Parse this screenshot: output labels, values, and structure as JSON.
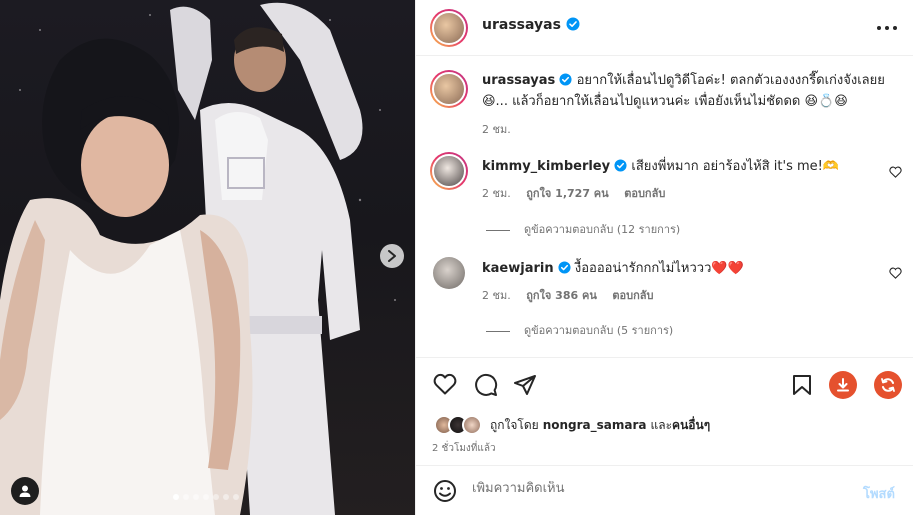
{
  "post": {
    "author": "urassayas",
    "caption_line1": "อยากให้เลื่อนไปดูวิดีโอค่ะ! ตลกตัวเองงงกรี๊ดเก่งจังเลยย",
    "caption_line2": "😆... แล้วก็อยากให้เลื่อนไปดูแหวนค่ะ เพื่อยังเห็นไม่ชัดดด 😆💍😆",
    "caption_time": "2 ชม."
  },
  "comments": [
    {
      "user": "kimmy_kimberley",
      "text": "เสียงพี่หมาก อย่าร้องไห้สิ it's me!🫶",
      "time": "2 ชม.",
      "likes": "ถูกใจ 1,727 คน",
      "reply_label": "ตอบกลับ",
      "view_replies": "ดูข้อความตอบกลับ (12 รายการ)"
    },
    {
      "user": "kaewjarin",
      "text": "งื้ออออน่ารักกกไม่ไหววว❤️❤️",
      "time": "2 ชม.",
      "likes": "ถูกใจ 386 คน",
      "reply_label": "ตอบกลับ",
      "view_replies": "ดูข้อความตอบกลับ (5 รายการ)"
    }
  ],
  "likes_summary": {
    "prefix": "ถูกใจโดย",
    "user": "nongra_samara",
    "conj": "และ",
    "others": "คนอื่นๆ"
  },
  "timestamp": "2 ชั่วโมงที่แล้ว",
  "composer": {
    "placeholder": "เพิ่มความคิดเห็น",
    "post_label": "โพสต์"
  },
  "carousel": {
    "count": 7,
    "active": 0
  },
  "colors": {
    "verified": "#0095f6",
    "download": "#e5512e",
    "secondary": "#737373",
    "heart": "#ed4956"
  },
  "icons": [
    "heart-icon",
    "comment-icon",
    "share-icon",
    "bookmark-icon",
    "download-icon",
    "refresh-icon",
    "chevron-right-icon",
    "user-icon",
    "emoji-icon",
    "more-icon",
    "verified-icon"
  ]
}
